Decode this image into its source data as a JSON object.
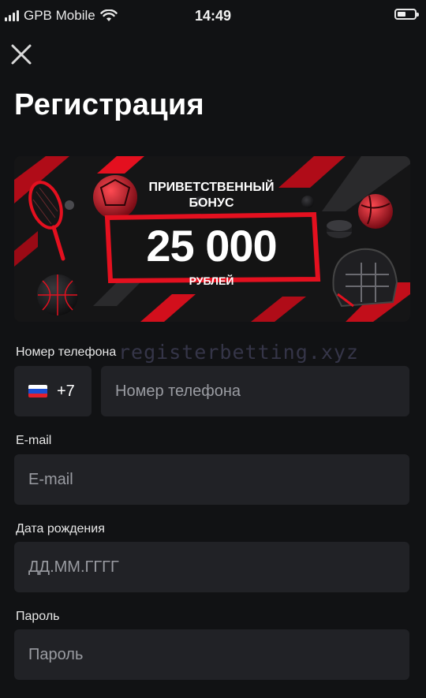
{
  "status_bar": {
    "carrier": "GPB Mobile",
    "time": "14:49",
    "battery_level": 0.5
  },
  "header": {
    "close_icon": "close-icon",
    "title": "Регистрация"
  },
  "banner": {
    "heading": "ПРИВЕТСТВЕННЫЙ БОНУС",
    "amount": "25 000",
    "currency": "РУБЛЕЙ",
    "accent_color": "#e4101f"
  },
  "watermark": "registerbetting.xyz",
  "form": {
    "phone": {
      "label": "Номер телефона",
      "country_flag": "russia-flag-icon",
      "country_code": "+7",
      "value": "",
      "placeholder": "Номер телефона"
    },
    "email": {
      "label": "E-mail",
      "value": "",
      "placeholder": "E-mail"
    },
    "birthdate": {
      "label": "Дата рождения",
      "value": "",
      "placeholder": "ДД.ММ.ГГГГ"
    },
    "password": {
      "label": "Пароль",
      "value": "",
      "placeholder": "Пароль"
    }
  },
  "colors": {
    "background": "#111214",
    "field_background": "#212226",
    "accent": "#e4101f"
  }
}
